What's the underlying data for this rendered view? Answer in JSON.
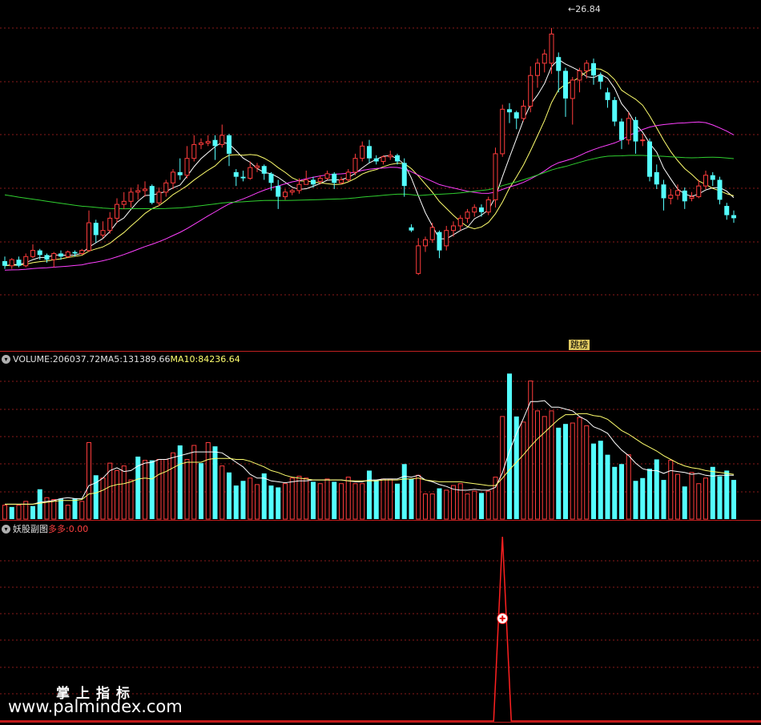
{
  "main_panel": {
    "high_marker": "26.84",
    "tag_label": "跳榜"
  },
  "volume_panel": {
    "header": {
      "prefix": "VOLUME: ",
      "vol": "206037.72",
      "ma5_label": " MA5: ",
      "ma5": "131389.66",
      "ma10_label": " MA10: ",
      "ma10": "84236.64"
    }
  },
  "indicator_panel": {
    "header": {
      "name": "妖股副图",
      "series": " 多多: ",
      "value": "0.00"
    }
  },
  "watermark": {
    "line1": "掌上指标",
    "line2": "www.palmindex.com"
  },
  "colors": {
    "up": "#ff3c3c",
    "down": "#54ffff",
    "ma_white": "#ffffff",
    "ma_yellow": "#ffff6e",
    "ma_magenta": "#ff40ff",
    "ma_green": "#30d030",
    "grid": "#8a1a1a",
    "separator": "#c02020"
  },
  "chart_data": [
    {
      "type": "candlestick",
      "title": "",
      "price_high_label": "26.84",
      "candles": [
        [
          11.6,
          11.3,
          11.9,
          11.1
        ],
        [
          11.3,
          11.7,
          11.8,
          11.1
        ],
        [
          11.7,
          11.3,
          11.9,
          11.2
        ],
        [
          11.3,
          11.9,
          12.1,
          11.2
        ],
        [
          11.9,
          12.3,
          12.7,
          11.8
        ],
        [
          12.3,
          12.0,
          12.4,
          11.7
        ],
        [
          12.0,
          11.7,
          12.1,
          11.5
        ],
        [
          11.7,
          12.1,
          12.2,
          11.2
        ],
        [
          12.1,
          11.9,
          12.3,
          11.7
        ],
        [
          11.9,
          12.2,
          12.3,
          11.8
        ],
        [
          12.2,
          12.1,
          12.3,
          11.9
        ],
        [
          12.1,
          12.3,
          12.4,
          12.0
        ],
        [
          12.3,
          14.1,
          14.9,
          12.2
        ],
        [
          14.1,
          13.3,
          14.3,
          12.8
        ],
        [
          13.3,
          13.6,
          14.2,
          13.1
        ],
        [
          13.6,
          14.4,
          14.8,
          13.4
        ],
        [
          14.4,
          15.3,
          15.7,
          14.1
        ],
        [
          15.3,
          15.5,
          16.1,
          15.0
        ],
        [
          15.5,
          16.1,
          16.4,
          15.1
        ],
        [
          16.1,
          16.2,
          16.6,
          15.6
        ],
        [
          16.2,
          16.3,
          16.8,
          15.8
        ],
        [
          16.5,
          15.4,
          16.6,
          15.3
        ],
        [
          15.4,
          16.1,
          16.4,
          15.2
        ],
        [
          16.1,
          16.7,
          16.9,
          15.8
        ],
        [
          16.7,
          17.4,
          17.6,
          16.3
        ],
        [
          17.4,
          17.2,
          18.3,
          16.9
        ],
        [
          17.2,
          18.3,
          19.1,
          17.0
        ],
        [
          18.3,
          19.2,
          19.8,
          18.1
        ],
        [
          19.2,
          19.3,
          19.6,
          18.9
        ],
        [
          19.3,
          19.4,
          19.8,
          19.1
        ],
        [
          19.5,
          19.1,
          19.8,
          18.2
        ],
        [
          19.2,
          19.8,
          20.5,
          19.0
        ],
        [
          19.8,
          18.6,
          19.9,
          17.8
        ],
        [
          17.4,
          17.1,
          17.6,
          16.5
        ],
        [
          17.1,
          17.0,
          17.5,
          16.8
        ],
        [
          17.0,
          17.7,
          18.1,
          16.9
        ],
        [
          17.7,
          17.8,
          18.0,
          17.4
        ],
        [
          17.8,
          17.3,
          17.9,
          16.9
        ],
        [
          17.3,
          16.7,
          17.4,
          16.2
        ],
        [
          16.5,
          15.8,
          16.9,
          15.0
        ],
        [
          15.8,
          16.1,
          16.3,
          15.6
        ],
        [
          16.1,
          16.2,
          16.3,
          15.9
        ],
        [
          16.2,
          16.6,
          17.0,
          16.0
        ],
        [
          16.6,
          16.9,
          17.5,
          16.6
        ],
        [
          16.9,
          16.6,
          17.1,
          16.4
        ],
        [
          16.8,
          17.0,
          17.2,
          16.6
        ],
        [
          17.0,
          17.3,
          17.5,
          16.9
        ],
        [
          17.3,
          16.7,
          17.4,
          16.3
        ],
        [
          16.7,
          16.9,
          17.1,
          16.6
        ],
        [
          16.9,
          17.4,
          17.6,
          16.8
        ],
        [
          17.4,
          18.3,
          18.6,
          17.2
        ],
        [
          18.3,
          19.1,
          19.4,
          18.1
        ],
        [
          19.1,
          18.3,
          19.5,
          18.0
        ],
        [
          18.3,
          18.1,
          18.5,
          17.9
        ],
        [
          18.1,
          18.4,
          18.5,
          17.9
        ],
        [
          18.4,
          18.5,
          18.8,
          18.2
        ],
        [
          18.5,
          18.1,
          18.6,
          17.9
        ],
        [
          18.0,
          16.5,
          18.3,
          15.8
        ],
        [
          13.8,
          13.6,
          14.0,
          13.5
        ],
        [
          10.8,
          12.6,
          13.1,
          10.7
        ],
        [
          12.6,
          13.0,
          13.2,
          12.2
        ],
        [
          13.0,
          13.8,
          14.1,
          12.8
        ],
        [
          13.5,
          12.3,
          13.6,
          11.8
        ],
        [
          12.6,
          13.6,
          13.9,
          12.3
        ],
        [
          13.6,
          13.9,
          14.2,
          13.2
        ],
        [
          13.9,
          14.4,
          14.6,
          13.6
        ],
        [
          14.4,
          14.8,
          15.0,
          14.1
        ],
        [
          14.8,
          15.1,
          15.3,
          14.5
        ],
        [
          15.1,
          14.8,
          15.3,
          14.5
        ],
        [
          14.8,
          15.6,
          15.8,
          14.6
        ],
        [
          15.6,
          18.6,
          19.0,
          15.1
        ],
        [
          18.6,
          21.5,
          21.8,
          18.4
        ],
        [
          21.5,
          21.3,
          21.9,
          20.6
        ],
        [
          21.3,
          20.9,
          21.4,
          20.2
        ],
        [
          20.9,
          21.7,
          22.1,
          20.7
        ],
        [
          21.7,
          23.7,
          24.3,
          21.3
        ],
        [
          23.7,
          24.5,
          24.8,
          22.9
        ],
        [
          24.5,
          25.1,
          25.4,
          23.9
        ],
        [
          24.5,
          26.4,
          26.8,
          23.8
        ],
        [
          24.9,
          24.0,
          25.2,
          22.6
        ],
        [
          24.0,
          22.2,
          24.2,
          21.0
        ],
        [
          22.2,
          23.4,
          23.6,
          20.5
        ],
        [
          23.4,
          24.0,
          24.2,
          22.6
        ],
        [
          24.0,
          24.5,
          24.7,
          23.5
        ],
        [
          24.5,
          23.7,
          24.8,
          23.1
        ],
        [
          23.7,
          23.3,
          23.9,
          22.8
        ],
        [
          22.6,
          22.1,
          22.9,
          21.6
        ],
        [
          22.1,
          20.7,
          22.3,
          20.4
        ],
        [
          20.7,
          19.5,
          20.9,
          18.9
        ],
        [
          19.5,
          20.9,
          21.3,
          19.2
        ],
        [
          20.8,
          19.4,
          21.0,
          18.6
        ],
        [
          19.5,
          19.5,
          19.9,
          19.1
        ],
        [
          19.4,
          17.1,
          19.6,
          16.8
        ],
        [
          17.4,
          16.6,
          17.9,
          16.3
        ],
        [
          16.6,
          15.7,
          16.9,
          14.9
        ],
        [
          15.7,
          15.9,
          16.3,
          15.3
        ],
        [
          15.9,
          16.2,
          16.6,
          15.6
        ],
        [
          16.2,
          15.5,
          16.4,
          15.0
        ],
        [
          15.7,
          15.8,
          16.1,
          15.5
        ],
        [
          15.8,
          16.5,
          16.9,
          15.7
        ],
        [
          16.5,
          17.2,
          17.5,
          16.3
        ],
        [
          17.2,
          16.9,
          17.4,
          16.5
        ],
        [
          16.9,
          15.6,
          17.1,
          15.3
        ],
        [
          15.2,
          14.6,
          15.4,
          14.3
        ],
        [
          14.6,
          14.4,
          14.9,
          14.1
        ]
      ],
      "price_range": [
        9.2,
        28.2
      ],
      "ma_series": [
        {
          "name": "MA5",
          "color": "#ffffff"
        },
        {
          "name": "MA10",
          "color": "#ffff6e"
        },
        {
          "name": "MA30",
          "color": "#ff40ff"
        },
        {
          "name": "MA60",
          "color": "#30d030"
        }
      ]
    },
    {
      "type": "bar",
      "title": "VOLUME",
      "values": [
        15,
        13,
        15,
        19,
        14,
        32,
        23,
        21,
        22,
        15,
        22,
        19,
        82,
        47,
        44,
        60,
        52,
        57,
        42,
        67,
        63,
        63,
        64,
        64,
        71,
        79,
        64,
        79,
        60,
        82,
        78,
        57,
        50,
        36,
        41,
        44,
        37,
        49,
        36,
        34,
        38,
        44,
        46,
        44,
        40,
        38,
        43,
        40,
        38,
        45,
        38,
        38,
        52,
        42,
        43,
        43,
        38,
        59,
        43,
        47,
        27,
        27,
        33,
        31,
        36,
        38,
        27,
        30,
        28,
        30,
        45,
        110,
        156,
        110,
        104,
        148,
        116,
        110,
        116,
        98,
        102,
        103,
        109,
        100,
        81,
        84,
        69,
        56,
        59,
        69,
        41,
        44,
        54,
        64,
        42,
        63,
        48,
        35,
        50,
        38,
        44,
        56,
        46,
        52,
        42
      ],
      "up": [
        1,
        0,
        1,
        1,
        0,
        0,
        1,
        1,
        0,
        1,
        0,
        1,
        1,
        0,
        1,
        1,
        1,
        1,
        1,
        0,
        1,
        0,
        1,
        1,
        1,
        0,
        1,
        1,
        0,
        1,
        0,
        1,
        0,
        0,
        0,
        1,
        1,
        0,
        0,
        0,
        1,
        1,
        1,
        1,
        0,
        1,
        1,
        0,
        1,
        1,
        1,
        1,
        0,
        0,
        1,
        1,
        0,
        0,
        0,
        1,
        1,
        1,
        0,
        1,
        1,
        1,
        1,
        1,
        0,
        1,
        1,
        1,
        0,
        0,
        1,
        1,
        1,
        1,
        1,
        0,
        0,
        1,
        1,
        1,
        0,
        0,
        0,
        0,
        0,
        1,
        0,
        0,
        0,
        0,
        0,
        1,
        1,
        0,
        1,
        1,
        1,
        0,
        0,
        0,
        0
      ],
      "ma5": [
        16,
        16,
        16,
        16,
        16,
        18,
        19,
        20,
        22,
        23,
        22,
        22,
        36,
        39,
        44,
        52,
        55,
        51,
        52,
        57,
        60,
        61,
        64,
        64,
        66,
        68,
        70,
        72,
        72,
        72,
        72,
        71,
        66,
        61,
        56,
        48,
        44,
        44,
        41,
        40,
        39,
        40,
        41,
        41,
        42,
        42,
        42,
        42,
        42,
        41,
        40,
        40,
        42,
        42,
        43,
        43,
        43,
        46,
        45,
        47,
        42,
        40,
        37,
        35,
        32,
        31,
        31,
        32,
        31,
        31,
        34,
        50,
        73,
        92,
        108,
        126,
        126,
        127,
        120,
        120,
        118,
        116,
        110,
        106,
        99,
        96,
        92,
        82,
        74,
        68,
        60,
        54,
        52,
        52,
        49,
        52,
        51,
        50,
        48,
        49,
        47,
        46,
        47,
        47,
        47
      ],
      "ma10": [
        16,
        16,
        16,
        16,
        16,
        17,
        18,
        19,
        20,
        20,
        20,
        21,
        27,
        28,
        31,
        35,
        37,
        38,
        40,
        43,
        44,
        43,
        48,
        51,
        55,
        59,
        61,
        61,
        61,
        64,
        65,
        65,
        65,
        64,
        64,
        62,
        59,
        56,
        52,
        50,
        47,
        45,
        44,
        43,
        42,
        42,
        42,
        42,
        42,
        41,
        41,
        41,
        41,
        41,
        42,
        42,
        42,
        43,
        43,
        44,
        42,
        41,
        40,
        40,
        40,
        40,
        39,
        38,
        37,
        36,
        36,
        44,
        53,
        61,
        69,
        78,
        86,
        93,
        100,
        107,
        112,
        112,
        113,
        113,
        111,
        110,
        107,
        101,
        95,
        91,
        86,
        81,
        77,
        73,
        68,
        64,
        60,
        57,
        55,
        54,
        52,
        51,
        50,
        49,
        48
      ],
      "range": [
        0,
        164
      ],
      "labels": {
        "VOLUME": "206037.72",
        "MA5": "131389.66",
        "MA10": "84236.64"
      }
    },
    {
      "type": "line",
      "title": "妖股副图",
      "series": [
        {
          "name": "多多",
          "current_value": "0.00",
          "spike_index": 71,
          "spike_value": 1
        }
      ]
    }
  ]
}
